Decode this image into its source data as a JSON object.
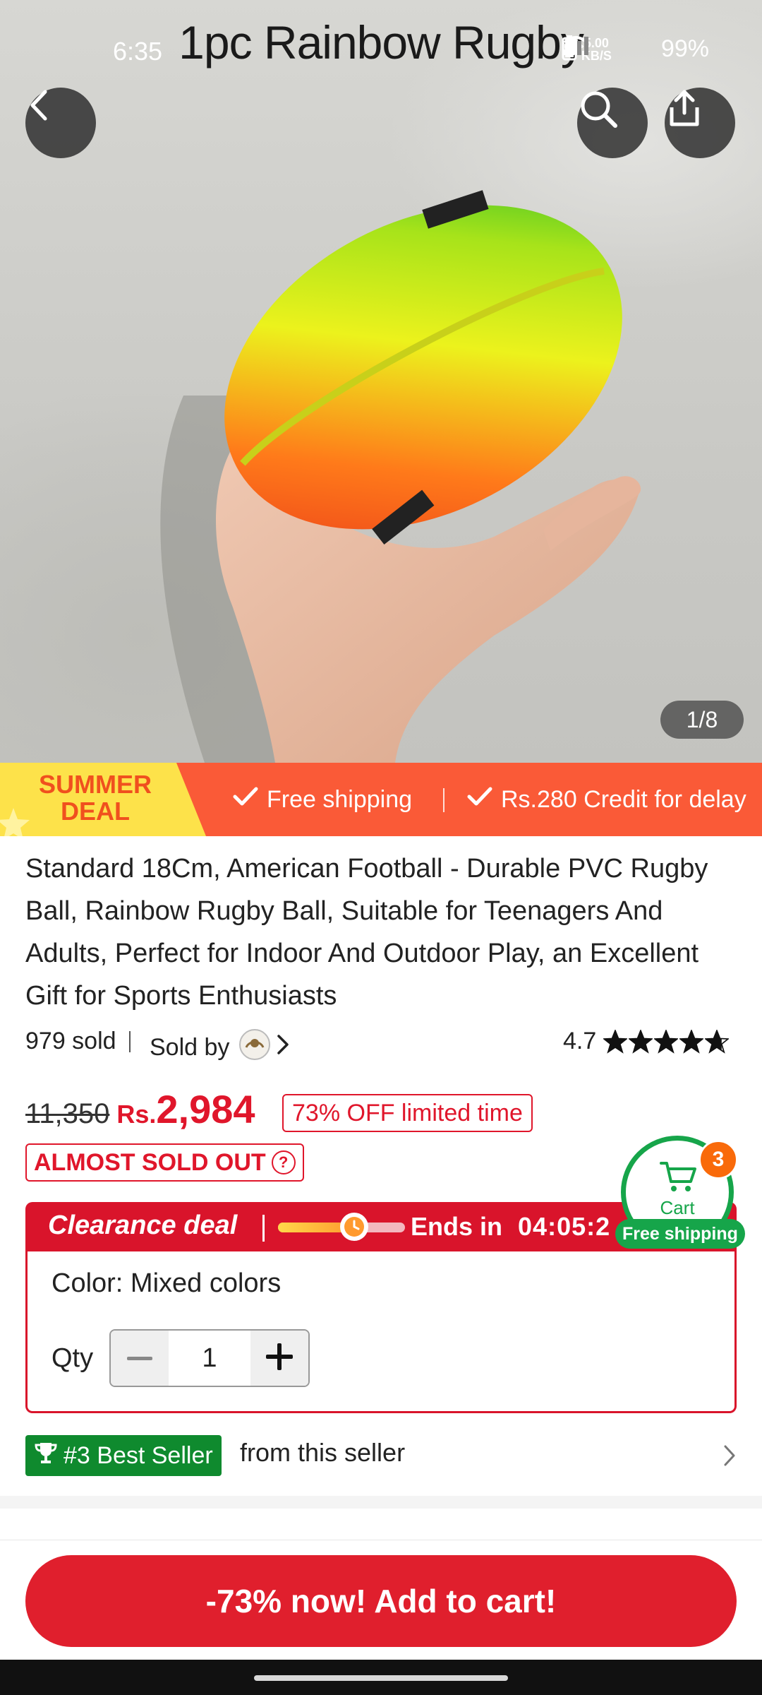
{
  "status_bar": {
    "time": "6:35",
    "speed_value": "5.00",
    "speed_unit": "KB/S",
    "battery": "99%"
  },
  "hero": {
    "title": "1pc Rainbow Rugby",
    "image_counter": "1/8",
    "icons": {
      "back": "chevron-left-icon",
      "search": "search-icon",
      "share": "share-icon"
    }
  },
  "promo": {
    "summer_line1": "SUMMER",
    "summer_line2": "DEAL",
    "free_shipping": "Free shipping",
    "credit": "Rs.280 Credit for delay"
  },
  "product": {
    "title": "Standard 18Cm, American Football - Durable PVC Rugby Ball, Rainbow Rugby Ball, Suitable for Teenagers And Adults, Perfect for Indoor And Outdoor Play, an Excellent Gift for Sports Enthusiasts",
    "sold": "979 sold",
    "sold_by": "Sold by",
    "rating": "4.7",
    "rating_stars": 4.7
  },
  "price": {
    "original": "11,350",
    "currency": "Rs.",
    "current": "2,984",
    "discount_badge": "73% OFF limited time",
    "almost_sold_out": "ALMOST SOLD OUT"
  },
  "clearance": {
    "label": "Clearance deal",
    "progress": 0.6,
    "ends_label": "Ends in",
    "countdown": "04:05:2"
  },
  "options": {
    "color_line": "Color: Mixed colors",
    "qty_label": "Qty",
    "qty_value": "1"
  },
  "cart": {
    "label": "Cart",
    "count": "3",
    "free_shipping": "Free shipping"
  },
  "best_seller": {
    "badge": "#3 Best Seller",
    "suffix": "from this seller"
  },
  "cta": {
    "label": "-73% now! Add to cart!"
  },
  "colors": {
    "accent_red": "#e0162b",
    "promo_orange": "#fa5a37",
    "summer_yellow": "#fde24a",
    "green": "#16a54a",
    "badge_orange": "#f96a0a"
  }
}
